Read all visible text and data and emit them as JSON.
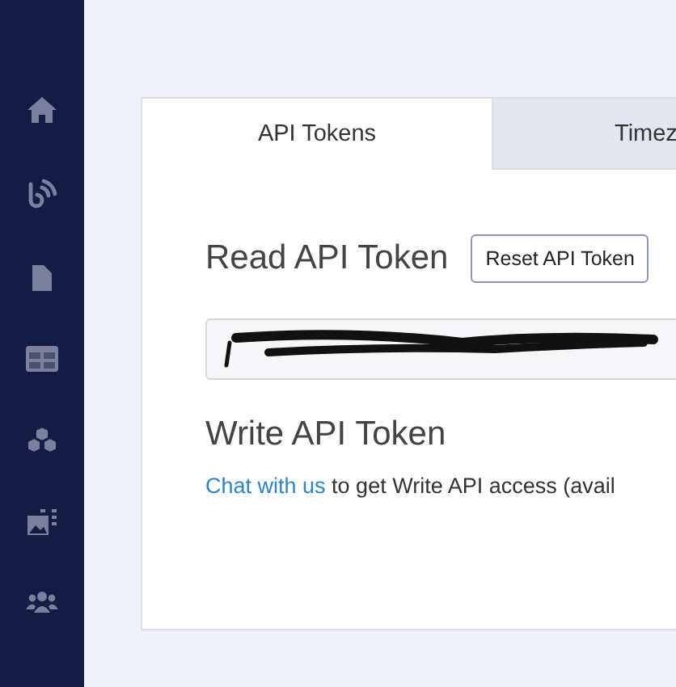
{
  "tabs": [
    {
      "label": "API Tokens",
      "selected": true
    },
    {
      "label": "Timez",
      "selected": false
    }
  ],
  "read_token": {
    "heading": "Read API Token",
    "reset_button": "Reset API Token",
    "field": {
      "redacted": true
    }
  },
  "write_token": {
    "heading": "Write API Token",
    "link": "Chat with us",
    "text": " to get Write API access (avail"
  }
}
